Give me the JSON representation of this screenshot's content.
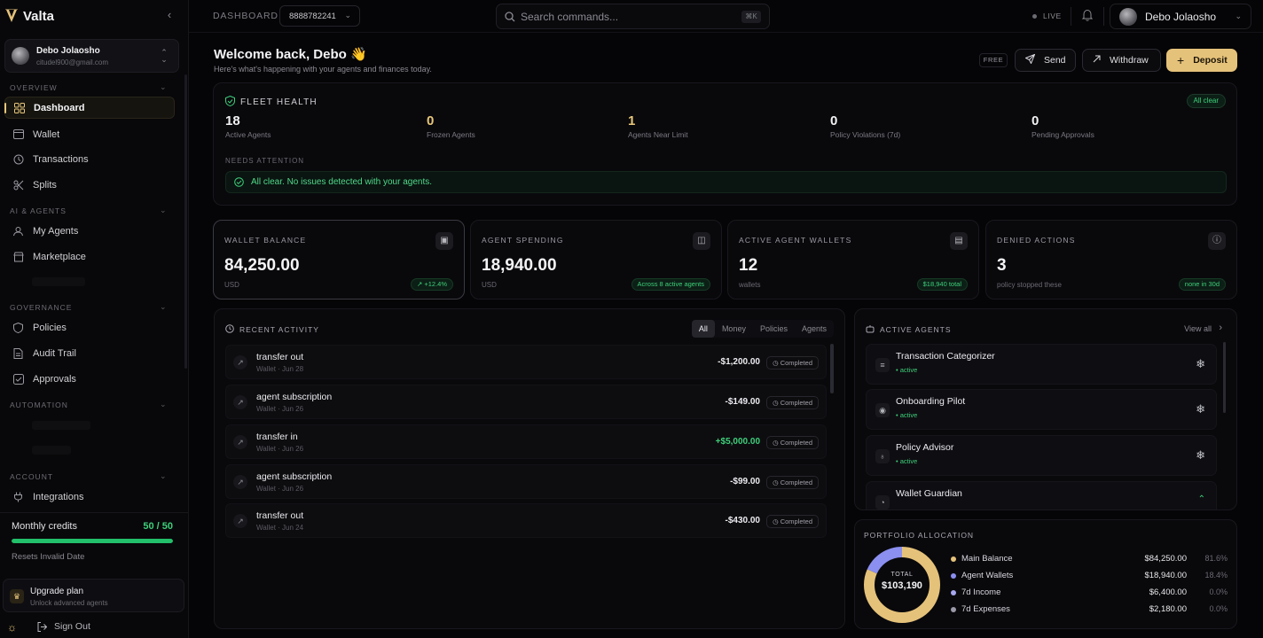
{
  "brand": {
    "name": "Valta"
  },
  "sidebar": {
    "user": {
      "name": "Debo Jolaosho",
      "email": "citudel900@gmail.com"
    },
    "sections": {
      "overview": "OVERVIEW",
      "ai_agents": "AI & AGENTS",
      "governance": "GOVERNANCE",
      "automation": "AUTOMATION",
      "account": "ACCOUNT"
    },
    "items": {
      "dashboard": "Dashboard",
      "wallet": "Wallet",
      "transactions": "Transactions",
      "splits": "Splits",
      "my_agents": "My Agents",
      "marketplace": "Marketplace",
      "policies": "Policies",
      "audit_trail": "Audit Trail",
      "approvals": "Approvals",
      "integrations": "Integrations"
    },
    "credits": {
      "title": "Monthly credits",
      "value": "50 / 50",
      "fraction": 1.0,
      "reset": "Resets Invalid Date"
    },
    "upgrade": {
      "title": "Upgrade plan",
      "subtitle": "Unlock advanced agents"
    },
    "sign_out": "Sign Out"
  },
  "topbar": {
    "breadcrumb": "DASHBOARD",
    "account_id": "8888782241",
    "search_placeholder": "Search commands...",
    "search_shortcut": "⌘K",
    "live": "LIVE",
    "user_name": "Debo Jolaosho"
  },
  "header": {
    "welcome": "Welcome back, Debo 👋",
    "subtitle": "Here's what's happening with your agents and finances today.",
    "plan": "FREE",
    "send": "Send",
    "withdraw": "Withdraw",
    "deposit": "Deposit"
  },
  "fleet": {
    "title": "FLEET HEALTH",
    "badge": "All clear",
    "stats": [
      {
        "value": "18",
        "label": "Active Agents"
      },
      {
        "value": "0",
        "label": "Frozen Agents"
      },
      {
        "value": "1",
        "label": "Agents Near Limit"
      },
      {
        "value": "0",
        "label": "Policy Violations (7d)"
      },
      {
        "value": "0",
        "label": "Pending Approvals"
      }
    ],
    "needs_attention": "NEEDS ATTENTION",
    "message": "All clear. No issues detected with your agents."
  },
  "kpis": [
    {
      "label": "WALLET BALANCE",
      "value": "84,250.00",
      "unit": "USD",
      "badge": "↗ +12.4%"
    },
    {
      "label": "AGENT SPENDING",
      "value": "18,940.00",
      "unit": "USD",
      "badge": "Across 8 active agents"
    },
    {
      "label": "ACTIVE AGENT WALLETS",
      "value": "12",
      "unit": "wallets",
      "badge": "$18,940 total"
    },
    {
      "label": "DENIED ACTIONS",
      "value": "3",
      "unit": "policy stopped these",
      "badge": "none in 30d"
    }
  ],
  "activity": {
    "title": "RECENT ACTIVITY",
    "filters": [
      "All",
      "Money",
      "Policies",
      "Agents"
    ],
    "rows": [
      {
        "title": "transfer out",
        "sub": "Wallet · Jun 28",
        "amount": "-$1,200.00",
        "status": "Completed"
      },
      {
        "title": "agent subscription",
        "sub": "Wallet · Jun 26",
        "amount": "-$149.00",
        "status": "Completed"
      },
      {
        "title": "transfer in",
        "sub": "Wallet · Jun 26",
        "amount": "+$5,000.00",
        "status": "Completed"
      },
      {
        "title": "agent subscription",
        "sub": "Wallet · Jun 26",
        "amount": "-$99.00",
        "status": "Completed"
      },
      {
        "title": "transfer out",
        "sub": "Wallet · Jun 24",
        "amount": "-$430.00",
        "status": "Completed"
      }
    ]
  },
  "agents": {
    "title": "ACTIVE AGENTS",
    "view_all": "View all",
    "rows": [
      {
        "name": "Transaction Categorizer",
        "status": "• active"
      },
      {
        "name": "Onboarding Pilot",
        "status": "• active"
      },
      {
        "name": "Policy Advisor",
        "status": "• active"
      },
      {
        "name": "Wallet Guardian",
        "status": ""
      }
    ]
  },
  "portfolio": {
    "title": "PORTFOLIO ALLOCATION",
    "total_label": "TOTAL",
    "total_value": "$103,190",
    "items": [
      {
        "name": "Main Balance",
        "value": "$84,250.00",
        "pct": "81.6%",
        "share": 81.6,
        "color": "#e5c27a"
      },
      {
        "name": "Agent Wallets",
        "value": "$18,940.00",
        "pct": "18.4%",
        "share": 18.4,
        "color": "#8b8ff0"
      },
      {
        "name": "7d Income",
        "value": "$6,400.00",
        "pct": "0.0%",
        "share": 0,
        "color": "#a8a8f0"
      },
      {
        "name": "7d Expenses",
        "value": "$2,180.00",
        "pct": "0.0%",
        "share": 0,
        "color": "#9a9aa8"
      }
    ]
  },
  "colors": {
    "accent": "#e5c27a",
    "success": "#3ecf7a",
    "background": "#050507"
  }
}
